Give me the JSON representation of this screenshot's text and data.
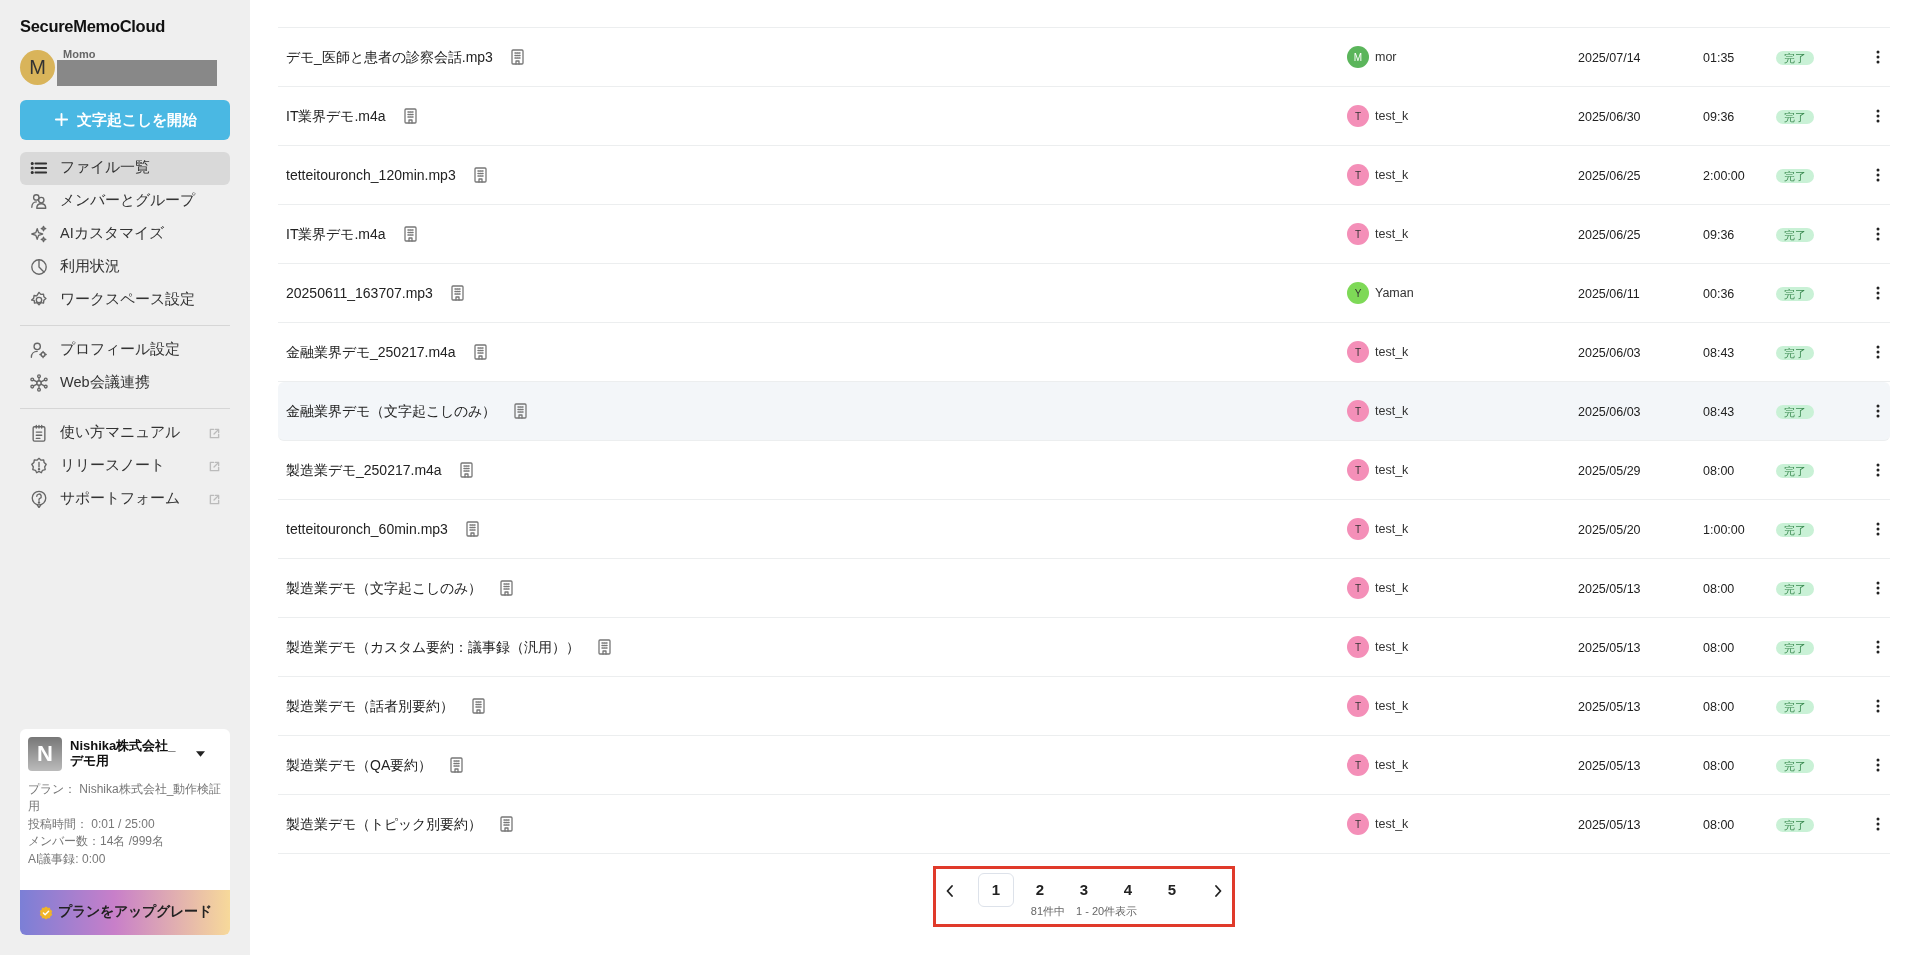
{
  "sidebar": {
    "logo": "SecureMemoCloud",
    "user": {
      "initial": "M",
      "name": "Momo",
      "color": "#d9b45a"
    },
    "start_button": "文字起こしを開始",
    "nav_groups": [
      [
        {
          "label": "ファイル一覧",
          "selected": true,
          "external": false
        },
        {
          "label": "メンバーとグループ",
          "selected": false,
          "external": false
        },
        {
          "label": "AIカスタマイズ",
          "selected": false,
          "external": false
        },
        {
          "label": "利用状況",
          "selected": false,
          "external": false
        },
        {
          "label": "ワークスペース設定",
          "selected": false,
          "external": false
        }
      ],
      [
        {
          "label": "プロフィール設定",
          "selected": false,
          "external": false
        },
        {
          "label": "Web会議連携",
          "selected": false,
          "external": false
        }
      ],
      [
        {
          "label": "使い方マニュアル",
          "selected": false,
          "external": true
        },
        {
          "label": "リリースノート",
          "selected": false,
          "external": true
        },
        {
          "label": "サポートフォーム",
          "selected": false,
          "external": true
        }
      ]
    ],
    "workspace": {
      "initial": "N",
      "name": "Nishika株式会社_デモ用",
      "details": [
        "プラン： Nishika株式会社_動作検証用",
        "投稿時間： 0:01 / 25:00",
        "メンバー数：14名 /999名",
        "AI議事録: 0:00"
      ],
      "upgrade_button": "プランをアップグレード"
    }
  },
  "files": [
    {
      "name": "デモ_医師と患者の診察会話.mp3",
      "user_initial": "M",
      "user": "mor",
      "color": "#5bb55b",
      "date": "2025/07/14",
      "duration": "01:35",
      "status": "完了",
      "selected": false
    },
    {
      "name": "IT業界デモ.m4a",
      "user_initial": "T",
      "user": "test_k",
      "color": "#f48fb8",
      "date": "2025/06/30",
      "duration": "09:36",
      "status": "完了",
      "selected": false
    },
    {
      "name": "tetteitouronch_120min.mp3",
      "user_initial": "T",
      "user": "test_k",
      "color": "#f48fb8",
      "date": "2025/06/25",
      "duration": "2:00:00",
      "status": "完了",
      "selected": false
    },
    {
      "name": "IT業界デモ.m4a",
      "user_initial": "T",
      "user": "test_k",
      "color": "#f48fb8",
      "date": "2025/06/25",
      "duration": "09:36",
      "status": "完了",
      "selected": false
    },
    {
      "name": "20250611_163707.mp3",
      "user_initial": "Y",
      "user": "Yaman",
      "color": "#7ed957",
      "date": "2025/06/11",
      "duration": "00:36",
      "status": "完了",
      "selected": false
    },
    {
      "name": "金融業界デモ_250217.m4a",
      "user_initial": "T",
      "user": "test_k",
      "color": "#f48fb8",
      "date": "2025/06/03",
      "duration": "08:43",
      "status": "完了",
      "selected": false
    },
    {
      "name": "金融業界デモ（文字起こしのみ）",
      "user_initial": "T",
      "user": "test_k",
      "color": "#f48fb8",
      "date": "2025/06/03",
      "duration": "08:43",
      "status": "完了",
      "selected": true
    },
    {
      "name": "製造業デモ_250217.m4a",
      "user_initial": "T",
      "user": "test_k",
      "color": "#f48fb8",
      "date": "2025/05/29",
      "duration": "08:00",
      "status": "完了",
      "selected": false
    },
    {
      "name": "tetteitouronch_60min.mp3",
      "user_initial": "T",
      "user": "test_k",
      "color": "#f48fb8",
      "date": "2025/05/20",
      "duration": "1:00:00",
      "status": "完了",
      "selected": false
    },
    {
      "name": "製造業デモ（文字起こしのみ）",
      "user_initial": "T",
      "user": "test_k",
      "color": "#f48fb8",
      "date": "2025/05/13",
      "duration": "08:00",
      "status": "完了",
      "selected": false
    },
    {
      "name": "製造業デモ（カスタム要約：議事録（汎用））",
      "user_initial": "T",
      "user": "test_k",
      "color": "#f48fb8",
      "date": "2025/05/13",
      "duration": "08:00",
      "status": "完了",
      "selected": false
    },
    {
      "name": "製造業デモ（話者別要約）",
      "user_initial": "T",
      "user": "test_k",
      "color": "#f48fb8",
      "date": "2025/05/13",
      "duration": "08:00",
      "status": "完了",
      "selected": false
    },
    {
      "name": "製造業デモ（QA要約）",
      "user_initial": "T",
      "user": "test_k",
      "color": "#f48fb8",
      "date": "2025/05/13",
      "duration": "08:00",
      "status": "完了",
      "selected": false
    },
    {
      "name": "製造業デモ（トピック別要約）",
      "user_initial": "T",
      "user": "test_k",
      "color": "#f48fb8",
      "date": "2025/05/13",
      "duration": "08:00",
      "status": "完了",
      "selected": false
    }
  ],
  "pagination": {
    "annotation_frame": true,
    "pages": [
      {
        "label": "1",
        "selected": true
      },
      {
        "label": "2",
        "selected": false
      },
      {
        "label": "3",
        "selected": false
      },
      {
        "label": "4",
        "selected": false
      },
      {
        "label": "5",
        "selected": false
      }
    ],
    "summary": "81件中　1 - 20件表示"
  }
}
